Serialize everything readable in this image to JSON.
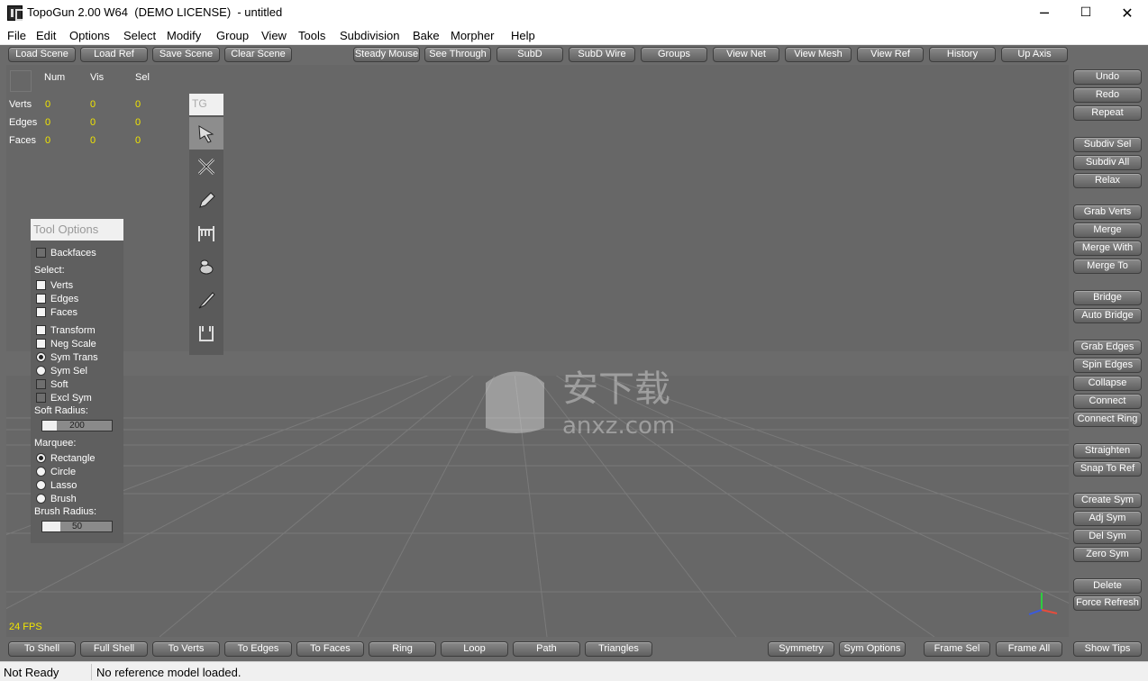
{
  "titlebar": {
    "title": "TopoGun 2.00 W64  (DEMO LICENSE)  - untitled",
    "minimize": "─",
    "maximize": "☐",
    "close": "✕"
  },
  "menu": [
    "File",
    "Edit",
    "Options",
    "Select",
    "Modify",
    "Group",
    "View",
    "Tools",
    "Subdivision",
    "Bake",
    "Morpher",
    "Help"
  ],
  "top_toolbar": {
    "left": [
      "Load Scene",
      "Load Ref",
      "Save Scene",
      "Clear Scene"
    ],
    "right": [
      "Steady Mouse",
      "See Through",
      "SubD",
      "SubD Wire",
      "Groups",
      "View Net",
      "View Mesh",
      "View Ref",
      "History",
      "Up Axis"
    ]
  },
  "right_panel": [
    "Undo",
    "Redo",
    "Repeat",
    "Subdiv Sel",
    "Subdiv All",
    "Relax",
    "Grab Verts",
    "Merge",
    "Merge With",
    "Merge To",
    "Bridge",
    "Auto Bridge",
    "Grab Edges",
    "Spin Edges",
    "Collapse",
    "Connect",
    "Connect Ring",
    "Straighten",
    "Snap To Ref",
    "Create Sym",
    "Adj Sym",
    "Del Sym",
    "Zero Sym",
    "Delete",
    "Force Refresh"
  ],
  "bottom_toolbar": {
    "left": [
      "To Shell",
      "Full Shell",
      "To Verts",
      "To Edges",
      "To Faces",
      "Ring",
      "Loop",
      "Path",
      "Triangles"
    ],
    "right": [
      "Symmetry",
      "Sym Options",
      "Frame Sel",
      "Frame All"
    ],
    "show_tips": "Show Tips"
  },
  "stats": {
    "headers": [
      "Num",
      "Vis",
      "Sel"
    ],
    "rows": [
      {
        "label": "Verts",
        "values": [
          "0",
          "0",
          "0"
        ]
      },
      {
        "label": "Edges",
        "values": [
          "0",
          "0",
          "0"
        ]
      },
      {
        "label": "Faces",
        "values": [
          "0",
          "0",
          "0"
        ]
      }
    ]
  },
  "tool_palette": {
    "header": "TG",
    "tools": [
      "select-arrow-icon",
      "cross-cut-icon",
      "pencil-icon",
      "bridge-icon",
      "brush-blob-icon",
      "knife-icon",
      "u-shape-icon"
    ]
  },
  "tool_options": {
    "header": "Tool Options",
    "backfaces": "Backfaces",
    "select_label": "Select:",
    "verts": "Verts",
    "edges": "Edges",
    "faces": "Faces",
    "transform": "Transform",
    "neg_scale": "Neg Scale",
    "sym_trans": "Sym Trans",
    "sym_sel": "Sym Sel",
    "soft": "Soft",
    "excl_sym": "Excl Sym",
    "soft_radius_label": "Soft Radius:",
    "soft_radius": "200",
    "marquee_label": "Marquee:",
    "rectangle": "Rectangle",
    "circle": "Circle",
    "lasso": "Lasso",
    "brush": "Brush",
    "brush_radius_label": "Brush Radius:",
    "brush_radius": "50"
  },
  "fps": "24 FPS",
  "status": {
    "left": "Not Ready",
    "right": "No reference model loaded."
  },
  "colors": {
    "stat_value": "#f2e600",
    "viewport": "#676767",
    "frame": "#6b6b6b"
  }
}
